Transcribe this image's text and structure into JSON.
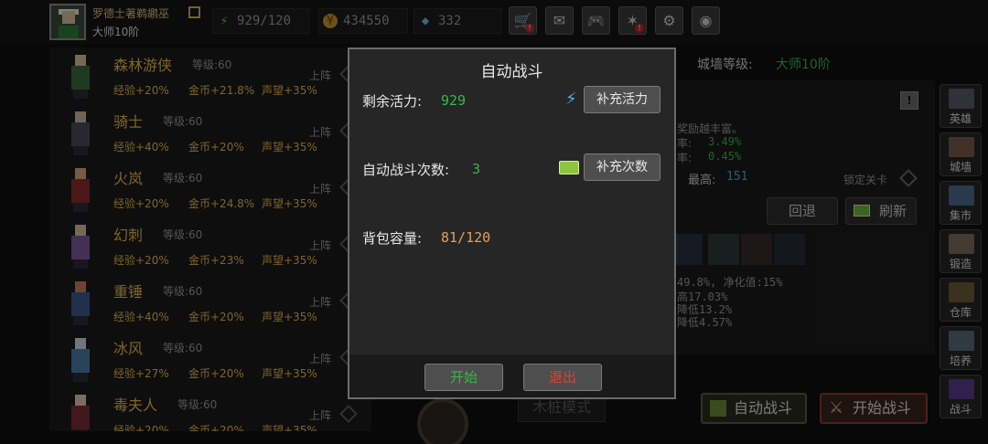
{
  "player": {
    "name": "罗德士著鹈鹕巫",
    "rank": "大师10阶"
  },
  "resources": {
    "energy": "929/120",
    "gold": "434550",
    "gems": "332"
  },
  "top_buttons": [
    {
      "icon": "shop-cart-icon",
      "glyph": "🛒",
      "alert": true
    },
    {
      "icon": "mail-icon",
      "glyph": "✉",
      "alert": false
    },
    {
      "icon": "gamepad-icon",
      "glyph": "🎮",
      "alert": false
    },
    {
      "icon": "skill-tree-icon",
      "glyph": "✶",
      "alert": true
    },
    {
      "icon": "settings-gear-icon",
      "glyph": "⚙",
      "alert": false
    },
    {
      "icon": "color-wheel-icon",
      "glyph": "◉",
      "alert": false
    }
  ],
  "heroes": [
    {
      "name": "森林游侠",
      "level": "等级:60",
      "exp": "经验+20%",
      "gold": "金币+21.8%",
      "fame": "声望+35%",
      "deploy": "上阵"
    },
    {
      "name": "骑士",
      "level": "等级:60",
      "exp": "经验+40%",
      "gold": "金币+20%",
      "fame": "声望+35%",
      "deploy": "上阵"
    },
    {
      "name": "火岚",
      "level": "等级:60",
      "exp": "经验+20%",
      "gold": "金币+24.8%",
      "fame": "声望+35%",
      "deploy": "上阵"
    },
    {
      "name": "幻刺",
      "level": "等级:60",
      "exp": "经验+20%",
      "gold": "金币+23%",
      "fame": "声望+35%",
      "deploy": "上阵"
    },
    {
      "name": "重锤",
      "level": "等级:60",
      "exp": "经验+40%",
      "gold": "金币+20%",
      "fame": "声望+35%",
      "deploy": "上阵"
    },
    {
      "name": "冰风",
      "level": "等级:60",
      "exp": "经验+27%",
      "gold": "金币+20%",
      "fame": "声望+35%",
      "deploy": "上阵"
    },
    {
      "name": "毒夫人",
      "level": "等级:60",
      "exp": "经验+20%",
      "gold": "金币+20%",
      "fame": "声望+35%",
      "deploy": "上阵"
    }
  ],
  "wall": {
    "label": "城墙等级:",
    "value": "大师10阶"
  },
  "right_panel": {
    "desc": "奖励越丰富。",
    "rate1_label": "率:",
    "rate1_value": "3.49%",
    "rate2_label": "率:",
    "rate2_value": "0.45%",
    "best_label": "最高:",
    "best_value": "151",
    "lock_label": "锁定关卡",
    "back_btn": "回退",
    "refresh_btn": "刷新",
    "stat1": "49.8%, 净化值:15%",
    "stat2": "高17.03%",
    "stat3": "降低13.2%",
    "stat4": "降低4.57%"
  },
  "side_nav": [
    "英雄",
    "城墙",
    "集市",
    "锻造",
    "仓库",
    "培养",
    "战斗"
  ],
  "bottom": {
    "auto_battle": "自动战斗",
    "start_battle": "开始战斗",
    "mode": "木桩模式"
  },
  "dialog": {
    "title": "自动战斗",
    "energy_label": "剩余活力:",
    "energy_value": "929",
    "refill_energy": "补充活力",
    "count_label": "自动战斗次数:",
    "count_value": "3",
    "refill_count": "补充次数",
    "bag_label": "背包容量:",
    "bag_value": "81/120",
    "start": "开始",
    "exit": "退出"
  },
  "colors": {
    "gold_text": "#e8b84a",
    "green_value": "#3ab54a",
    "orange_value": "#e0a060",
    "exit_red": "#e04030"
  }
}
